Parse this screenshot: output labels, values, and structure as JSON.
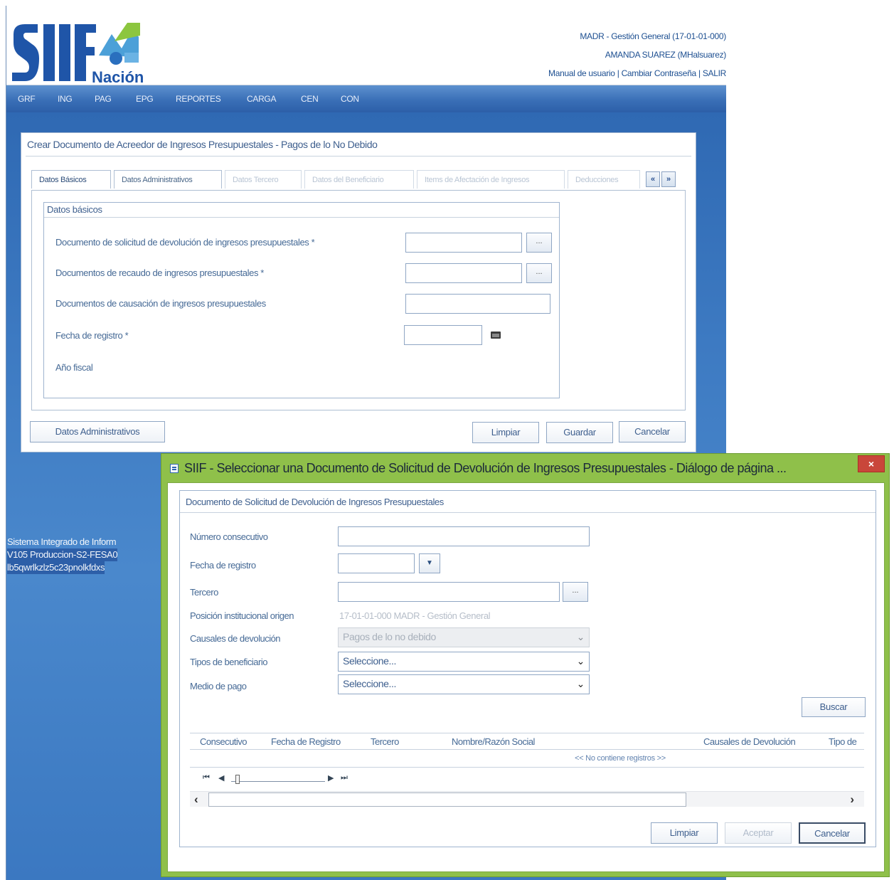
{
  "header": {
    "brand": "SIIF",
    "brand_sub": "Nación",
    "org": "MADR - Gestión General (17-01-01-000)",
    "user": "AMANDA SUAREZ (MHalsuarez)",
    "link_manual": "Manual de usuario",
    "sep": "|",
    "link_password": "Cambiar Contraseña",
    "link_exit": "SALIR"
  },
  "menu": [
    "GRF",
    "ING",
    "PAG",
    "EPG",
    "REPORTES",
    "CARGA",
    "CEN",
    "CON"
  ],
  "form": {
    "title": "Crear Documento de Acreedor de Ingresos Presupuestales - Pagos de lo No Debido",
    "tabs": [
      {
        "label": "Datos Básicos"
      },
      {
        "label": "Datos Administrativos"
      },
      {
        "label": "Datos Tercero"
      },
      {
        "label": "Datos del Beneficiario"
      },
      {
        "label": "Items de Afectación de Ingresos"
      },
      {
        "label": "Deducciones"
      }
    ],
    "tab_prev": "«",
    "tab_next": "»",
    "fieldset_legend": "Datos básicos",
    "fields": {
      "solicitud_label": "Documento de solicitud de devolución de ingresos presupuestales *",
      "recaudo_label": "Documentos de recaudo de ingresos presupuestales *",
      "causacion_label": "Documentos de causación de ingresos presupuestales",
      "fecha_label": "Fecha de registro *",
      "anio_label": "Año fiscal",
      "ellipsis": "..."
    },
    "buttons": {
      "datos_admin": "Datos Administrativos",
      "limpiar": "Limpiar",
      "guardar": "Guardar",
      "cancelar": "Cancelar"
    }
  },
  "footer": {
    "line1": "Sistema Integrado de Inform",
    "line2": "V105 Produccion-S2-FESA0",
    "line3": "lb5qwrlkzlz5c23pnolkfdxs"
  },
  "dialog": {
    "title": "SIIF - Seleccionar una Documento de Solicitud de Devolución de Ingresos Presupuestales - Diálogo de página ...",
    "close": "×",
    "panel_title": "Documento de Solicitud de Devolución de Ingresos Presupuestales",
    "labels": {
      "numero": "Número consecutivo",
      "fecha": "Fecha de registro",
      "tercero": "Tercero",
      "posicion": "Posición institucional origen",
      "causales": "Causales de devolución",
      "tipos": "Tipos de beneficiario",
      "medio": "Medio de pago"
    },
    "values": {
      "posicion": "17-01-01-000 MADR - Gestión General",
      "causales": "Pagos de lo no debido",
      "tipos": "Seleccione...",
      "medio": "Seleccione..."
    },
    "ellipsis": "...",
    "dropdown_arrow": "▼",
    "select_arrow": "⌄",
    "buscar": "Buscar",
    "grid": {
      "columns": [
        "Consecutivo",
        "Fecha de Registro",
        "Tercero",
        "Nombre/Razón Social",
        "Causales de Devolución",
        "Tipo de"
      ],
      "empty": "<< No contiene registros >>"
    },
    "pager": {
      "first": "⏮",
      "prev": "◀",
      "next": "▶",
      "last": "⏭"
    },
    "hscroll": {
      "left": "‹",
      "right": "›"
    },
    "buttons": {
      "limpiar": "Limpiar",
      "aceptar": "Aceptar",
      "cancelar": "Cancelar"
    }
  },
  "colors": {
    "brand_blue": "#1d4f91",
    "dialog_green": "#8fc04a",
    "close_red": "#c9463a"
  }
}
